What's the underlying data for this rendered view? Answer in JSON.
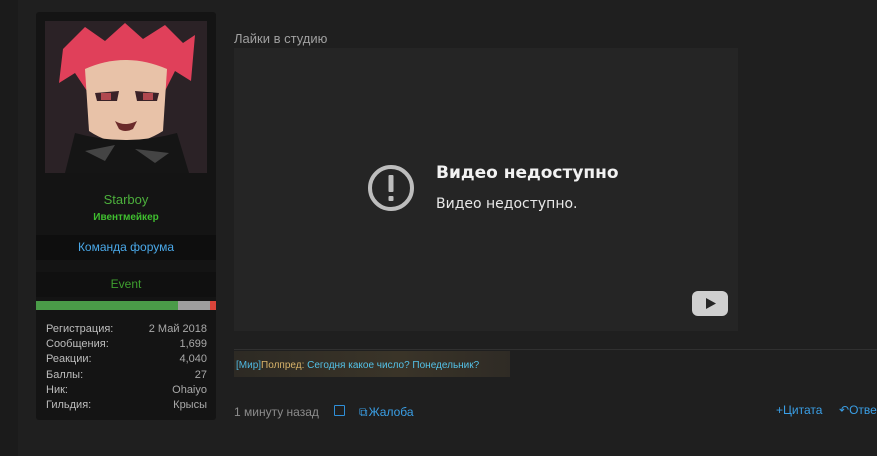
{
  "user": {
    "username": "Starboy",
    "title": "Ивентмейкер",
    "banner_team": "Команда форума",
    "banner_event": "Event",
    "reputation_fraction": 0.79,
    "stats": [
      {
        "label": "Регистрация:",
        "value": "2 Май 2018"
      },
      {
        "label": "Сообщения:",
        "value": "1,699"
      },
      {
        "label": "Реакции:",
        "value": "4,040"
      },
      {
        "label": "Баллы:",
        "value": "27"
      },
      {
        "label": "Ник:",
        "value": "Ohaiyo"
      },
      {
        "label": "Гильдия:",
        "value": "Крысы"
      }
    ]
  },
  "post": {
    "title": "Лайки в студию",
    "video": {
      "error_title": "Видео недоступно",
      "error_subtitle": "Видео недоступно."
    },
    "signature": {
      "tag": "[Мир]",
      "nick": "Полпред",
      "separator": ":",
      "message": "Сегодня какое число? Понедельник?"
    },
    "time": "1 минуту назад",
    "complaint_label": "Жалоба",
    "quote_label": "Цитата",
    "reply_label": "Отве"
  },
  "colors": {
    "accent_blue": "#3a9fe6",
    "username_green": "#4caf3c",
    "rep_green": "#4a9b48",
    "rep_grey": "#9e9e9e",
    "rep_red": "#d9443a"
  }
}
